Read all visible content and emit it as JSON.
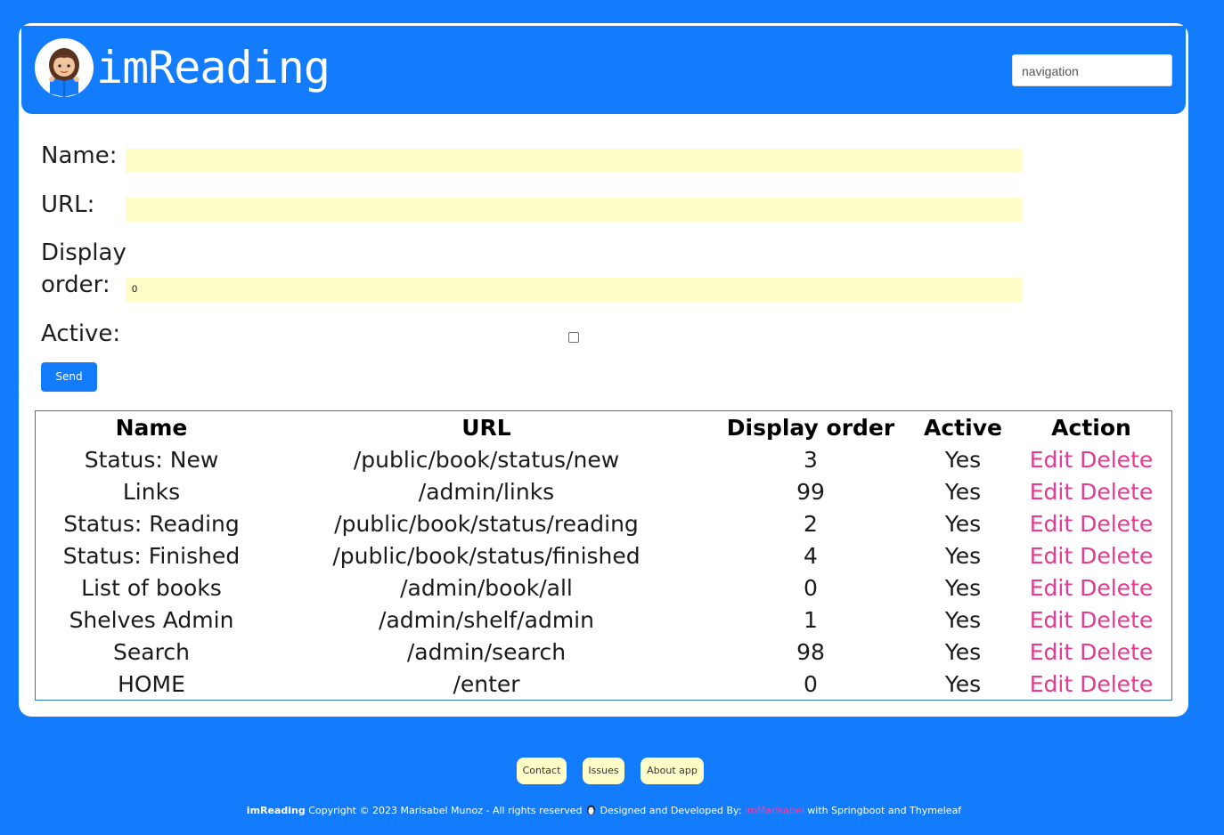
{
  "app": {
    "title": "imReading"
  },
  "header": {
    "navigation_select": "navigation"
  },
  "form": {
    "name_label": "Name:",
    "name_value": "",
    "url_label": "URL:",
    "url_value": "",
    "display_label_line1": "Display",
    "display_label_line2": "order:",
    "display_value": "0",
    "active_label": "Active:",
    "active_checked": false,
    "send_label": "Send"
  },
  "table": {
    "headers": [
      "Name",
      "URL",
      "Display order",
      "Active",
      "Action"
    ],
    "rows": [
      {
        "name": "Status: New",
        "url": "/public/book/status/new",
        "order": "3",
        "active": "Yes",
        "edit": "Edit",
        "delete": "Delete"
      },
      {
        "name": "Links",
        "url": "/admin/links",
        "order": "99",
        "active": "Yes",
        "edit": "Edit",
        "delete": "Delete"
      },
      {
        "name": "Status: Reading",
        "url": "/public/book/status/reading",
        "order": "2",
        "active": "Yes",
        "edit": "Edit",
        "delete": "Delete"
      },
      {
        "name": "Status: Finished",
        "url": "/public/book/status/finished",
        "order": "4",
        "active": "Yes",
        "edit": "Edit",
        "delete": "Delete"
      },
      {
        "name": "List of books",
        "url": "/admin/book/all",
        "order": "0",
        "active": "Yes",
        "edit": "Edit",
        "delete": "Delete"
      },
      {
        "name": "Shelves Admin",
        "url": "/admin/shelf/admin",
        "order": "1",
        "active": "Yes",
        "edit": "Edit",
        "delete": "Delete"
      },
      {
        "name": "Search",
        "url": "/admin/search",
        "order": "98",
        "active": "Yes",
        "edit": "Edit",
        "delete": "Delete"
      },
      {
        "name": "HOME",
        "url": "/enter",
        "order": "0",
        "active": "Yes",
        "edit": "Edit",
        "delete": "Delete"
      }
    ]
  },
  "footer": {
    "buttons": [
      "Contact",
      "Issues",
      "About app"
    ],
    "brand": "imReading",
    "copyright": "Copyright © 2023 Marisabel Munoz - All rights reserved",
    "designed": "Designed and Developed By:",
    "author": "imMarisabel",
    "tech": "with Springboot and Thymeleaf"
  },
  "colors": {
    "primary": "#127cfc",
    "input_bg": "#fffdc8",
    "link": "#e8388f",
    "author": "#ff3a9a"
  }
}
